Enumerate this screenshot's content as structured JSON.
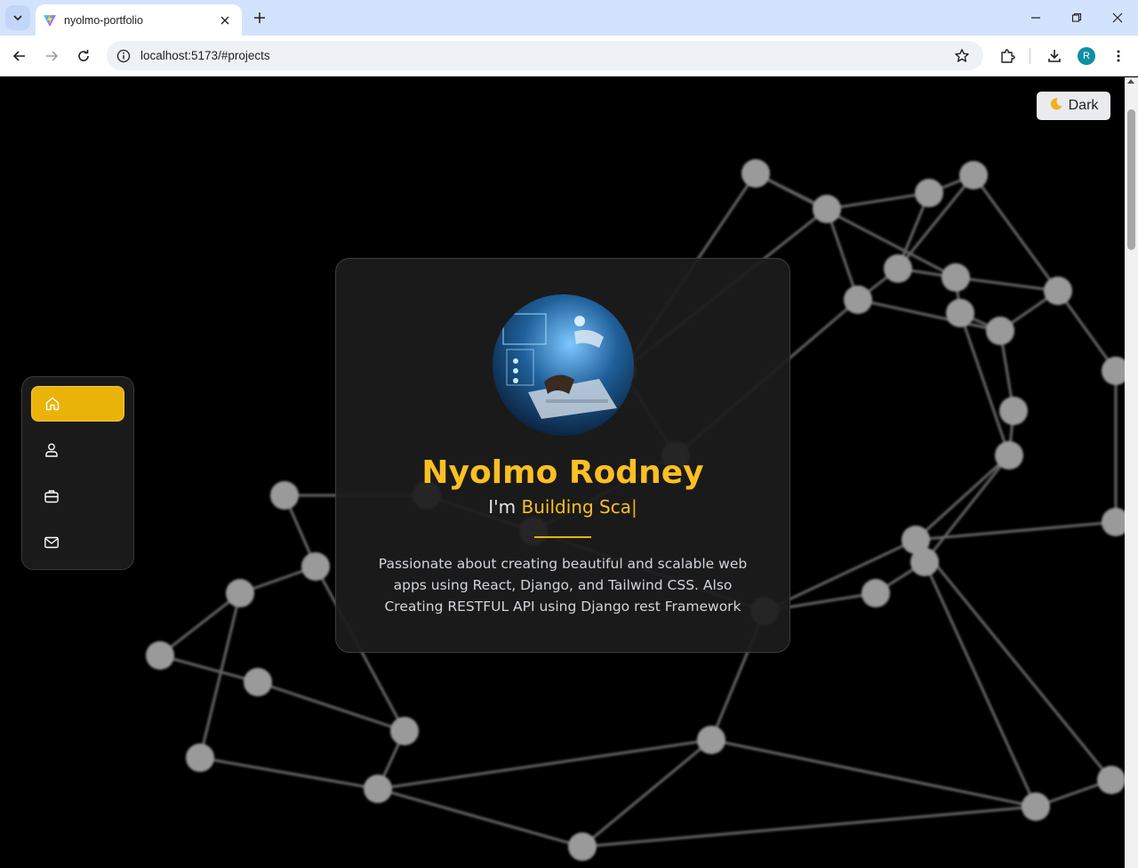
{
  "browser": {
    "tab_title": "nyolmo-portfolio",
    "url": "localhost:5173/#projects",
    "profile_initial": "R"
  },
  "page": {
    "theme_toggle": {
      "icon": "moon-icon",
      "label": "Dark"
    },
    "nav": [
      {
        "name": "home",
        "icon": "home-icon",
        "active": true
      },
      {
        "name": "about",
        "icon": "user-icon",
        "active": false
      },
      {
        "name": "projects",
        "icon": "briefcase-icon",
        "active": false
      },
      {
        "name": "contact",
        "icon": "mail-icon",
        "active": false
      }
    ],
    "hero": {
      "name": "Nyolmo Rodney",
      "tag_prefix": "I'm ",
      "tag_typed": "Building Sca",
      "tag_cursor": "|",
      "description": "Passionate about creating beautiful and scalable web apps using React, Django, and Tailwind CSS. Also Creating RESTFUL API using Django rest Framework"
    },
    "colors": {
      "accent": "#eab308",
      "name_color": "#fbbf24",
      "background": "#000000",
      "card": "#1c1c1c"
    }
  }
}
